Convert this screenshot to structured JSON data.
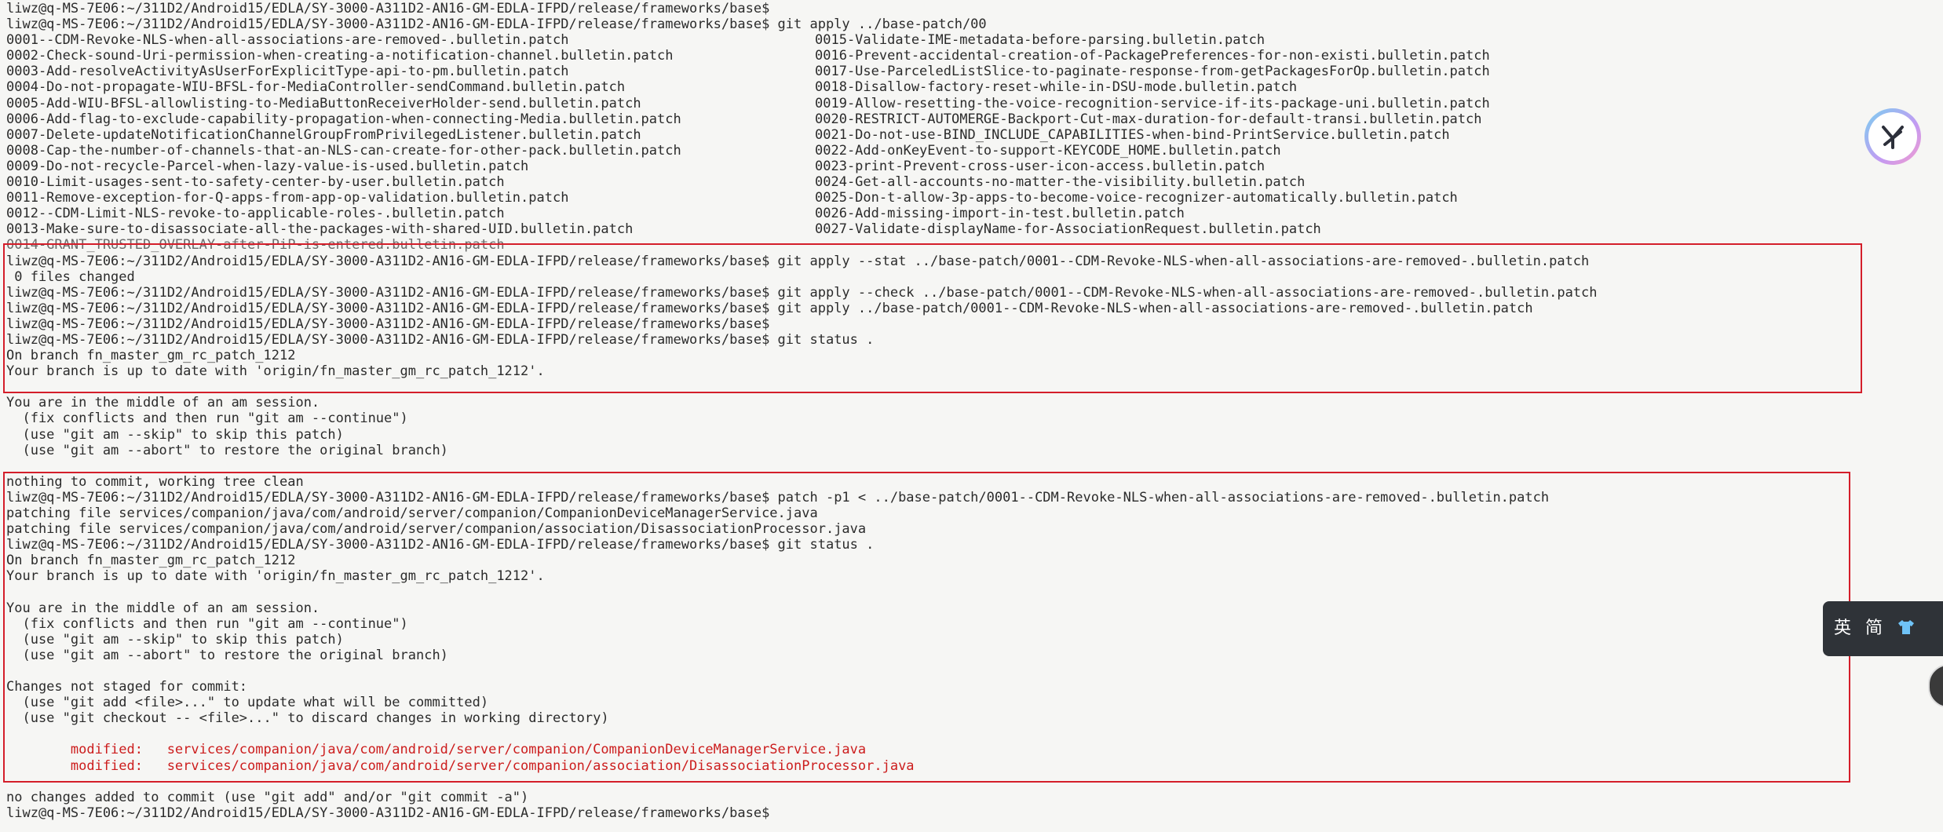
{
  "terminal": {
    "prompt": "liwz@q-MS-7E06:~/311D2/Android15/EDLA/SY-3000-A311D2-AN16-GM-EDLA-IFPD/release/frameworks/base$",
    "lines": [
      {
        "text": "liwz@q-MS-7E06:~/311D2/Android15/EDLA/SY-3000-A311D2-AN16-GM-EDLA-IFPD/release/frameworks/base$"
      },
      {
        "text": "liwz@q-MS-7E06:~/311D2/Android15/EDLA/SY-3000-A311D2-AN16-GM-EDLA-IFPD/release/frameworks/base$ git apply ../base-patch/00"
      }
    ],
    "patch_list": [
      [
        "0001--CDM-Revoke-NLS-when-all-associations-are-removed-.bulletin.patch",
        "0015-Validate-IME-metadata-before-parsing.bulletin.patch"
      ],
      [
        "0002-Check-sound-Uri-permission-when-creating-a-notification-channel.bulletin.patch",
        "0016-Prevent-accidental-creation-of-PackagePreferences-for-non-existi.bulletin.patch"
      ],
      [
        "0003-Add-resolveActivityAsUserForExplicitType-api-to-pm.bulletin.patch",
        "0017-Use-ParceledListSlice-to-paginate-response-from-getPackagesForOp.bulletin.patch"
      ],
      [
        "0004-Do-not-propagate-WIU-BFSL-for-MediaController-sendCommand.bulletin.patch",
        "0018-Disallow-factory-reset-while-in-DSU-mode.bulletin.patch"
      ],
      [
        "0005-Add-WIU-BFSL-allowlisting-to-MediaButtonReceiverHolder-send.bulletin.patch",
        "0019-Allow-resetting-the-voice-recognition-service-if-its-package-uni.bulletin.patch"
      ],
      [
        "0006-Add-flag-to-exclude-capability-propagation-when-connecting-Media.bulletin.patch",
        "0020-RESTRICT-AUTOMERGE-Backport-Cut-max-duration-for-default-transi.bulletin.patch"
      ],
      [
        "0007-Delete-updateNotificationChannelGroupFromPrivilegedListener.bulletin.patch",
        "0021-Do-not-use-BIND_INCLUDE_CAPABILITIES-when-bind-PrintService.bulletin.patch"
      ],
      [
        "0008-Cap-the-number-of-channels-that-an-NLS-can-create-for-other-pack.bulletin.patch",
        "0022-Add-onKeyEvent-to-support-KEYCODE_HOME.bulletin.patch"
      ],
      [
        "0009-Do-not-recycle-Parcel-when-lazy-value-is-used.bulletin.patch",
        "0023-print-Prevent-cross-user-icon-access.bulletin.patch"
      ],
      [
        "0010-Limit-usages-sent-to-safety-center-by-user.bulletin.patch",
        "0024-Get-all-accounts-no-matter-the-visibility.bulletin.patch"
      ],
      [
        "0011-Remove-exception-for-Q-apps-from-app-op-validation.bulletin.patch",
        "0025-Don-t-allow-3p-apps-to-become-voice-recognizer-automatically.bulletin.patch"
      ],
      [
        "0012--CDM-Limit-NLS-revoke-to-applicable-roles-.bulletin.patch",
        "0026-Add-missing-import-in-test.bulletin.patch"
      ],
      [
        "0013-Make-sure-to-disassociate-all-the-packages-with-shared-UID.bulletin.patch",
        "0027-Validate-displayName-for-AssociationRequest.bulletin.patch"
      ]
    ],
    "struck_line": "0014-GRANT_TRUSTED_OVERLAY-after-PiP-is-entered.bulletin.patch",
    "block1": [
      "liwz@q-MS-7E06:~/311D2/Android15/EDLA/SY-3000-A311D2-AN16-GM-EDLA-IFPD/release/frameworks/base$ git apply --stat ../base-patch/0001--CDM-Revoke-NLS-when-all-associations-are-removed-.bulletin.patch",
      " 0 files changed",
      "liwz@q-MS-7E06:~/311D2/Android15/EDLA/SY-3000-A311D2-AN16-GM-EDLA-IFPD/release/frameworks/base$ git apply --check ../base-patch/0001--CDM-Revoke-NLS-when-all-associations-are-removed-.bulletin.patch",
      "liwz@q-MS-7E06:~/311D2/Android15/EDLA/SY-3000-A311D2-AN16-GM-EDLA-IFPD/release/frameworks/base$ git apply ../base-patch/0001--CDM-Revoke-NLS-when-all-associations-are-removed-.bulletin.patch",
      "liwz@q-MS-7E06:~/311D2/Android15/EDLA/SY-3000-A311D2-AN16-GM-EDLA-IFPD/release/frameworks/base$",
      "liwz@q-MS-7E06:~/311D2/Android15/EDLA/SY-3000-A311D2-AN16-GM-EDLA-IFPD/release/frameworks/base$ git status .",
      "On branch fn_master_gm_rc_patch_1212",
      "Your branch is up to date with 'origin/fn_master_gm_rc_patch_1212'."
    ],
    "am_session": [
      "",
      "You are in the middle of an am session.",
      "  (fix conflicts and then run \"git am --continue\")",
      "  (use \"git am --skip\" to skip this patch)",
      "  (use \"git am --abort\" to restore the original branch)",
      ""
    ],
    "block2": [
      "nothing to commit, working tree clean",
      "liwz@q-MS-7E06:~/311D2/Android15/EDLA/SY-3000-A311D2-AN16-GM-EDLA-IFPD/release/frameworks/base$ patch -p1 < ../base-patch/0001--CDM-Revoke-NLS-when-all-associations-are-removed-.bulletin.patch",
      "patching file services/companion/java/com/android/server/companion/CompanionDeviceManagerService.java",
      "patching file services/companion/java/com/android/server/companion/association/DisassociationProcessor.java",
      "liwz@q-MS-7E06:~/311D2/Android15/EDLA/SY-3000-A311D2-AN16-GM-EDLA-IFPD/release/frameworks/base$ git status .",
      "On branch fn_master_gm_rc_patch_1212",
      "Your branch is up to date with 'origin/fn_master_gm_rc_patch_1212'.",
      "",
      "You are in the middle of an am session.",
      "  (fix conflicts and then run \"git am --continue\")",
      "  (use \"git am --skip\" to skip this patch)",
      "  (use \"git am --abort\" to restore the original branch)",
      "",
      "Changes not staged for commit:",
      "  (use \"git add <file>...\" to update what will be committed)",
      "  (use \"git checkout -- <file>...\" to discard changes in working directory)",
      ""
    ],
    "modified": [
      "        modified:   services/companion/java/com/android/server/companion/CompanionDeviceManagerService.java",
      "        modified:   services/companion/java/com/android/server/companion/association/DisassociationProcessor.java"
    ],
    "tail": [
      "",
      "no changes added to commit (use \"git add\" and/or \"git commit -a\")",
      "liwz@q-MS-7E06:~/311D2/Android15/EDLA/SY-3000-A311D2-AN16-GM-EDLA-IFPD/release/frameworks/base$"
    ]
  },
  "ime_toolbar": {
    "lang": "英",
    "mode": "简",
    "skin_icon": "shirt-icon"
  },
  "floating_widget_icon": "assistant-logo-icon",
  "colors": {
    "background": "#f6f6f4",
    "text": "#2b2b2b",
    "modified_text": "#cc1d1d",
    "highlight_box": "#d41e2a"
  }
}
